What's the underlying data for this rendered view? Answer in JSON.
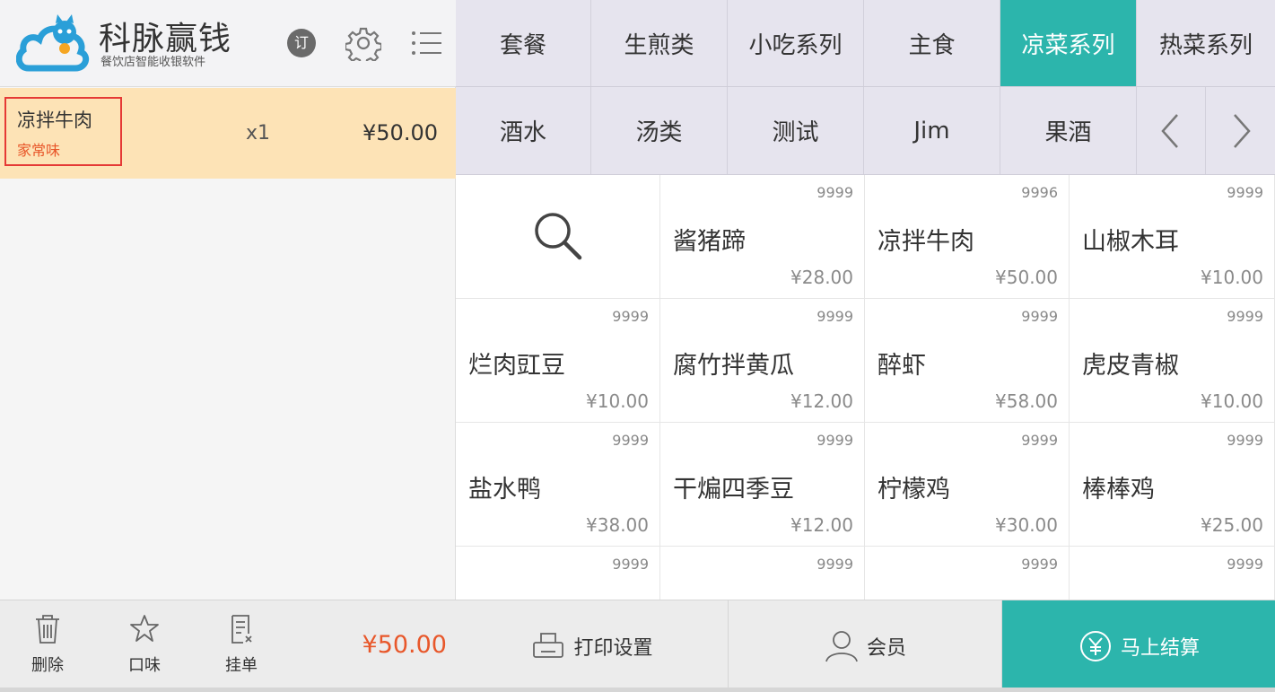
{
  "header": {
    "brand_name": "科脉赢钱",
    "brand_sub": "餐饮店智能收银软件",
    "order_badge": "订"
  },
  "cart": {
    "items": [
      {
        "name": "凉拌牛肉",
        "flavor": "家常味",
        "qty": "x1",
        "price": "¥50.00"
      }
    ],
    "total": "¥50.00"
  },
  "left_footer": {
    "delete_label": "删除",
    "flavor_label": "口味",
    "hold_label": "挂单"
  },
  "categories_row1": [
    "套餐",
    "生煎类",
    "小吃系列",
    "主食",
    "凉菜系列",
    "热菜系列"
  ],
  "active_category": "凉菜系列",
  "categories_row2": [
    "酒水",
    "汤类",
    "测试",
    "Jim",
    "果酒"
  ],
  "products": [
    {
      "name": "酱猪蹄",
      "stock": "9999",
      "price": "¥28.00"
    },
    {
      "name": "凉拌牛肉",
      "stock": "9996",
      "price": "¥50.00"
    },
    {
      "name": "山椒木耳",
      "stock": "9999",
      "price": "¥10.00"
    },
    {
      "name": "烂肉豇豆",
      "stock": "9999",
      "price": "¥10.00"
    },
    {
      "name": "腐竹拌黄瓜",
      "stock": "9999",
      "price": "¥12.00"
    },
    {
      "name": "醉虾",
      "stock": "9999",
      "price": "¥58.00"
    },
    {
      "name": "虎皮青椒",
      "stock": "9999",
      "price": "¥10.00"
    },
    {
      "name": "盐水鸭",
      "stock": "9999",
      "price": "¥38.00"
    },
    {
      "name": "干煸四季豆",
      "stock": "9999",
      "price": "¥12.00"
    },
    {
      "name": "柠檬鸡",
      "stock": "9999",
      "price": "¥30.00"
    },
    {
      "name": "棒棒鸡",
      "stock": "9999",
      "price": "¥25.00"
    },
    {
      "name": "",
      "stock": "9999",
      "price": ""
    },
    {
      "name": "",
      "stock": "9999",
      "price": ""
    },
    {
      "name": "",
      "stock": "9999",
      "price": ""
    },
    {
      "name": "",
      "stock": "9999",
      "price": ""
    }
  ],
  "right_footer": {
    "print_label": "打印设置",
    "member_label": "会员",
    "checkout_label": "马上结算"
  },
  "colors": {
    "accent": "#2cb5ac",
    "price_highlight": "#e8572a",
    "cart_row_bg": "#fde3b6"
  }
}
